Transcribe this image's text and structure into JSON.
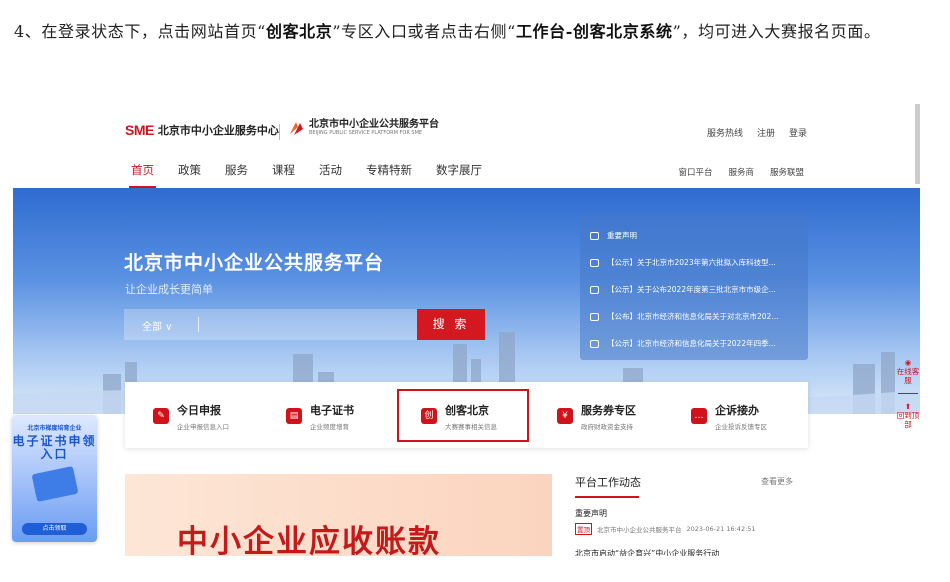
{
  "doc": {
    "prefix": "4、在登录状态下，点击网站首页“",
    "bold1": "创客北京",
    "mid": "”专区入口或者点击右侧“",
    "bold2": "工作台-创客北京系统",
    "suffix": "”，均可进入大赛报名页面。"
  },
  "site": {
    "logo_sme": "SME",
    "logo1_text": "北京市中小企业服务中心",
    "logo2_cn": "北京市中小企业公共服务平台",
    "logo2_en": "BEIJING PUBLIC SERVICE PLATFORM FOR SME",
    "top_links": [
      "服务热线",
      "注册",
      "登录"
    ],
    "nav": [
      "首页",
      "政策",
      "服务",
      "课程",
      "活动",
      "专精特新",
      "数字展厅"
    ],
    "nav_right": [
      "窗口平台",
      "服务商",
      "服务联盟"
    ],
    "banner_title": "北京市中小企业公共服务平台",
    "banner_sub": "让企业成长更简单",
    "search_select": "全部 ∨",
    "search_button": "搜 索",
    "notices": [
      "重要声明",
      "【公示】关于北京市2023年第六批拟入库科技型...",
      "【公示】关于公布2022年度第三批北京市市级企...",
      "【公布】北京市经济和信息化局关于对北京市202...",
      "【公示】北京市经济和信息化局关于2022年四季..."
    ],
    "side_float": {
      "online": "在线客服",
      "top": "回到顶部"
    },
    "cards": [
      {
        "name": "今日申报",
        "desc": "企业申报信息入口",
        "glyph": "✎"
      },
      {
        "name": "电子证书",
        "desc": "企业频度增育",
        "glyph": "▤"
      },
      {
        "name": "创客北京",
        "desc": "大赛赛事相关信息",
        "glyph": "创"
      },
      {
        "name": "服务券专区",
        "desc": "政府财政资金支持",
        "glyph": "¥"
      },
      {
        "name": "企诉接办",
        "desc": "企业投诉反馈专区",
        "glyph": "…"
      }
    ],
    "lower_banner": "中小企业应收账款",
    "news": {
      "header": "平台工作动态",
      "more": "查看更多",
      "item1": "重要声明",
      "item1_tag": "置顶",
      "item1_meta": "北京市中小企业公共服务平台",
      "item1_date": "2023-06-21 16:42:51",
      "item2": "北京市启动“益企育兴”中小企业服务行动"
    },
    "promo": {
      "line1": "北京市梯度培育企业",
      "line2": "电子证书申领入口",
      "button": "点击领取"
    }
  }
}
